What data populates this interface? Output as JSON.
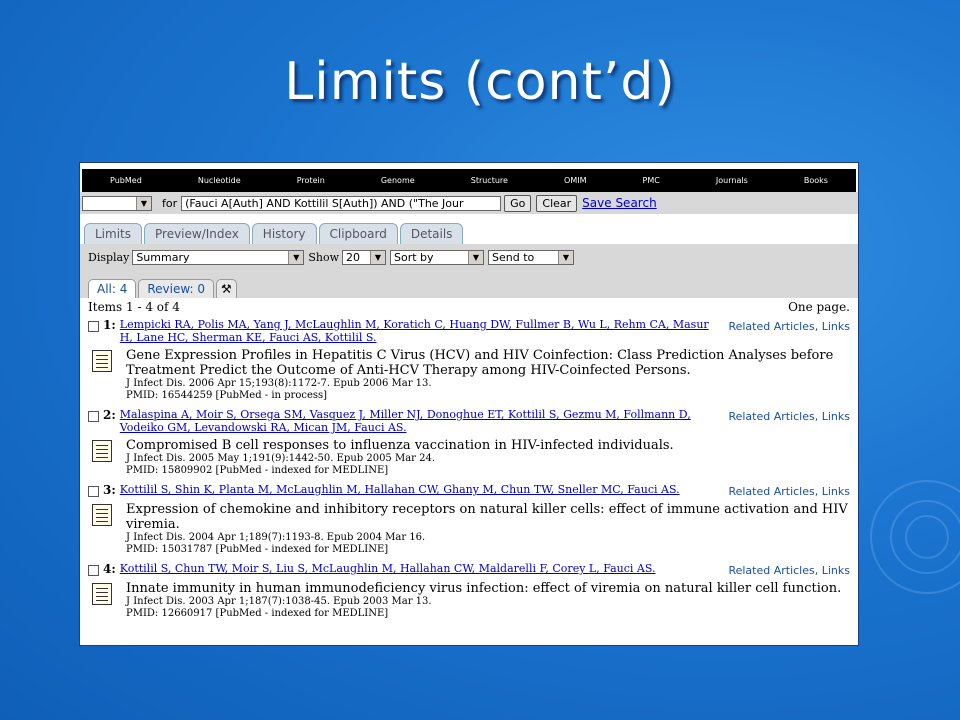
{
  "slide": {
    "title": "Limits (cont’d)"
  },
  "nav": [
    "PubMed",
    "Nucleotide",
    "Protein",
    "Genome",
    "Structure",
    "OMIM",
    "PMC",
    "Journals",
    "Books"
  ],
  "search": {
    "for_label": "for",
    "query": "(Fauci A[Auth] AND Kottilil S[Auth]) AND (\"The Jour",
    "go": "Go",
    "clear": "Clear",
    "save": "Save Search"
  },
  "tabs": [
    "Limits",
    "Preview/Index",
    "History",
    "Clipboard",
    "Details"
  ],
  "display": {
    "display_label": "Display",
    "display_value": "Summary",
    "show_label": "Show",
    "show_value": "20",
    "sort_value": "Sort by",
    "send_value": "Send to"
  },
  "subtabs": {
    "all": "All: 4",
    "review": "Review: 0"
  },
  "results": {
    "items": "Items 1 - 4 of 4",
    "pages": "One page."
  },
  "entries": [
    {
      "num": "1:",
      "authors": "Lempicki RA, Polis MA, Yang J, McLaughlin M, Koratich C, Huang DW, Fullmer B, Wu L, Rehm CA, Masur H, Lane HC, Sherman KE, Fauci AS, Kottilil S.",
      "title": "Gene Expression Profiles in Hepatitis C Virus (HCV) and HIV Coinfection: Class Prediction Analyses before Treatment Predict the Outcome of Anti-HCV Therapy among HIV-Coinfected Persons.",
      "journal": "J Infect Dis. 2006 Apr 15;193(8):1172-7. Epub 2006 Mar 13.",
      "pmid": "PMID: 16544259 [PubMed - in process]",
      "related": "Related Articles,",
      "links": "Links"
    },
    {
      "num": "2:",
      "authors": "Malaspina A, Moir S, Orsega SM, Vasquez J, Miller NJ, Donoghue ET, Kottilil S, Gezmu M, Follmann D, Vodeiko GM, Levandowski RA, Mican JM, Fauci AS.",
      "title": "Compromised B cell responses to influenza vaccination in HIV-infected individuals.",
      "journal": "J Infect Dis. 2005 May 1;191(9):1442-50. Epub 2005 Mar 24.",
      "pmid": "PMID: 15809902 [PubMed - indexed for MEDLINE]",
      "related": "Related Articles,",
      "links": "Links"
    },
    {
      "num": "3:",
      "authors": "Kottilil S, Shin K, Planta M, McLaughlin M, Hallahan CW, Ghany M, Chun TW, Sneller MC, Fauci AS.",
      "title": "Expression of chemokine and inhibitory receptors on natural killer cells: effect of immune activation and HIV viremia.",
      "journal": "J Infect Dis. 2004 Apr 1;189(7):1193-8. Epub 2004 Mar 16.",
      "pmid": "PMID: 15031787 [PubMed - indexed for MEDLINE]",
      "related": "Related Articles,",
      "links": "Links"
    },
    {
      "num": "4:",
      "authors": "Kottilil S, Chun TW, Moir S, Liu S, McLaughlin M, Hallahan CW, Maldarelli F, Corey L, Fauci AS.",
      "title": "Innate immunity in human immunodeficiency virus infection: effect of viremia on natural killer cell function.",
      "journal": "J Infect Dis. 2003 Apr 1;187(7):1038-45. Epub 2003 Mar 13.",
      "pmid": "PMID: 12660917 [PubMed - indexed for MEDLINE]",
      "related": "Related Articles,",
      "links": "Links"
    }
  ]
}
